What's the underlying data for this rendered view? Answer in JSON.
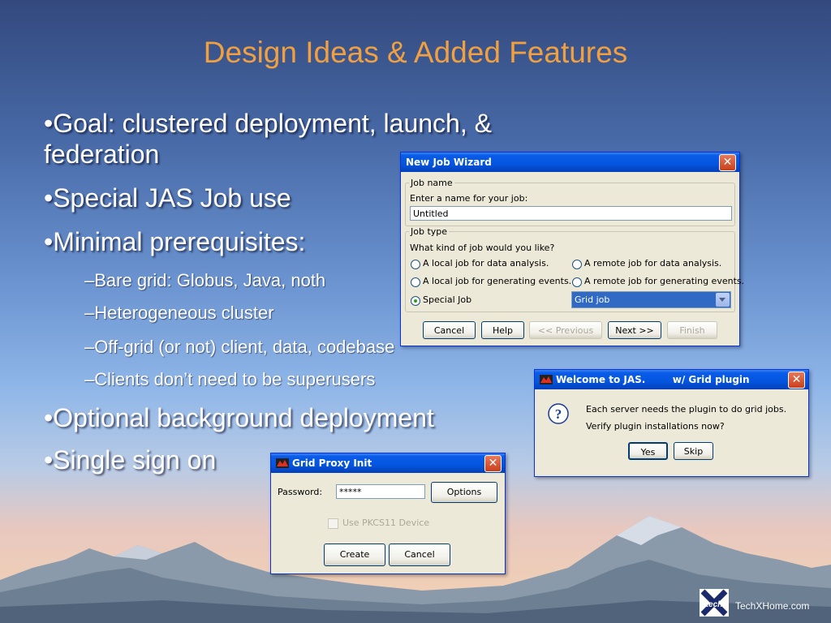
{
  "slide": {
    "title": "Design Ideas & Added Features",
    "bullets": [
      {
        "text": "•Goal:  clustered deployment, launch, &"
      },
      {
        "text": "federation"
      },
      {
        "text": "•Special JAS Job use"
      },
      {
        "text": "•Minimal prerequisites:"
      },
      {
        "text": "–Bare grid:  Globus, Java, noth"
      },
      {
        "text": "–Heterogeneous cluster"
      },
      {
        "text": "–Off-grid (or not) client, data, codebase"
      },
      {
        "text": "–Clients don’t need to be superusers"
      },
      {
        "text": "•Optional background deployment"
      },
      {
        "text": "•Single sign on"
      }
    ],
    "footer_text": "TechXHome.com",
    "logo_text": "tech"
  },
  "wizard": {
    "title": "New Job Wizard",
    "job_name_group": "Job name",
    "job_name_prompt": "Enter a name for your job:",
    "job_name_value": "Untitled",
    "job_type_group": "Job type",
    "job_type_prompt": "What kind of job would you like?",
    "options": {
      "local_analysis": "A local job for data analysis.",
      "remote_analysis": "A remote job for data analysis.",
      "local_events": "A local job for generating events.",
      "remote_events": "A remote job for generating events.",
      "special": "Special Job"
    },
    "special_select": "Grid job",
    "buttons": {
      "cancel": "Cancel",
      "help": "Help",
      "previous": "<< Previous",
      "next": "Next >>",
      "finish": "Finish"
    }
  },
  "welcome": {
    "title": "Welcome to JAS.        w/ Grid plugin",
    "line1": "Each server needs the plugin to do grid jobs.",
    "line2": "Verify plugin installations now?",
    "yes": "Yes",
    "skip": "Skip"
  },
  "proxy": {
    "title": "Grid Proxy Init",
    "password_label": "Password:",
    "password_value": "*****",
    "options": "Options",
    "pkcs_label": "Use PKCS11 Device",
    "create": "Create",
    "cancel": "Cancel"
  },
  "colors": {
    "title": "#f0a040",
    "titlebar": "#0455e0",
    "window": "#ece9d8"
  }
}
